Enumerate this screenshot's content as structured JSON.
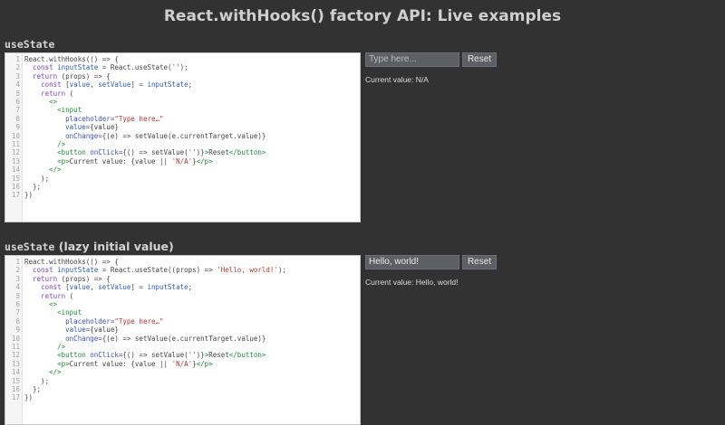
{
  "page": {
    "title": "React.withHooks() factory API: Live examples"
  },
  "examples": [
    {
      "heading_code": "useState",
      "heading_suffix": "",
      "code_lines": [
        [
          {
            "t": "React.withHooks(() => {",
            "c": "p"
          }
        ],
        [
          {
            "t": "  ",
            "c": "p"
          },
          {
            "t": "const",
            "c": "kw"
          },
          {
            "t": " ",
            "c": "p"
          },
          {
            "t": "inputState",
            "c": "var"
          },
          {
            "t": " = React.useState(",
            "c": "p"
          },
          {
            "t": "''",
            "c": "str"
          },
          {
            "t": ");",
            "c": "p"
          }
        ],
        [
          {
            "t": "  ",
            "c": "p"
          },
          {
            "t": "return",
            "c": "kw"
          },
          {
            "t": " (props) => {",
            "c": "p"
          }
        ],
        [
          {
            "t": "    ",
            "c": "p"
          },
          {
            "t": "const",
            "c": "kw"
          },
          {
            "t": " [",
            "c": "p"
          },
          {
            "t": "value",
            "c": "var"
          },
          {
            "t": ", ",
            "c": "p"
          },
          {
            "t": "setValue",
            "c": "var"
          },
          {
            "t": "] = ",
            "c": "p"
          },
          {
            "t": "inputState",
            "c": "var"
          },
          {
            "t": ";",
            "c": "p"
          }
        ],
        [
          {
            "t": "    ",
            "c": "p"
          },
          {
            "t": "return",
            "c": "kw"
          },
          {
            "t": " (",
            "c": "p"
          }
        ],
        [
          {
            "t": "      ",
            "c": "p"
          },
          {
            "t": "<>",
            "c": "tag"
          }
        ],
        [
          {
            "t": "        ",
            "c": "p"
          },
          {
            "t": "<input",
            "c": "tag"
          }
        ],
        [
          {
            "t": "          ",
            "c": "p"
          },
          {
            "t": "placeholder",
            "c": "attr"
          },
          {
            "t": "=",
            "c": "p"
          },
          {
            "t": "\"Type here…\"",
            "c": "str"
          }
        ],
        [
          {
            "t": "          ",
            "c": "p"
          },
          {
            "t": "value",
            "c": "attr"
          },
          {
            "t": "={value}",
            "c": "p"
          }
        ],
        [
          {
            "t": "          ",
            "c": "p"
          },
          {
            "t": "onChange",
            "c": "attr"
          },
          {
            "t": "={(e) => setValue(e.currentTarget.value)}",
            "c": "p"
          }
        ],
        [
          {
            "t": "        ",
            "c": "p"
          },
          {
            "t": "/>",
            "c": "tag"
          }
        ],
        [
          {
            "t": "        ",
            "c": "p"
          },
          {
            "t": "<button",
            "c": "tag"
          },
          {
            "t": " ",
            "c": "p"
          },
          {
            "t": "onClick",
            "c": "attr"
          },
          {
            "t": "={() => setValue(",
            "c": "p"
          },
          {
            "t": "''",
            "c": "str"
          },
          {
            "t": ")}",
            "c": "p"
          },
          {
            "t": ">",
            "c": "tag"
          },
          {
            "t": "Reset",
            "c": "p"
          },
          {
            "t": "</button>",
            "c": "tag"
          }
        ],
        [
          {
            "t": "        ",
            "c": "p"
          },
          {
            "t": "<p>",
            "c": "tag"
          },
          {
            "t": "Current value: {value || ",
            "c": "p"
          },
          {
            "t": "'N/A'",
            "c": "str"
          },
          {
            "t": "}",
            "c": "p"
          },
          {
            "t": "</p>",
            "c": "tag"
          }
        ],
        [
          {
            "t": "      ",
            "c": "p"
          },
          {
            "t": "</>",
            "c": "tag"
          }
        ],
        [
          {
            "t": "    );",
            "c": "p"
          }
        ],
        [
          {
            "t": "  };",
            "c": "p"
          }
        ],
        [
          {
            "t": "})",
            "c": "p"
          }
        ]
      ],
      "input_value": "",
      "input_placeholder": "Type here...",
      "reset_label": "Reset",
      "current_value_text": "Current value: N/A"
    },
    {
      "heading_code": "useState",
      "heading_suffix": " (lazy initial value)",
      "code_lines": [
        [
          {
            "t": "React.withHooks(() => {",
            "c": "p"
          }
        ],
        [
          {
            "t": "  ",
            "c": "p"
          },
          {
            "t": "const",
            "c": "kw"
          },
          {
            "t": " ",
            "c": "p"
          },
          {
            "t": "inputState",
            "c": "var"
          },
          {
            "t": " = React.useState((props) => ",
            "c": "p"
          },
          {
            "t": "'Hello, world!'",
            "c": "str"
          },
          {
            "t": ");",
            "c": "p"
          }
        ],
        [
          {
            "t": "  ",
            "c": "p"
          },
          {
            "t": "return",
            "c": "kw"
          },
          {
            "t": " (props) => {",
            "c": "p"
          }
        ],
        [
          {
            "t": "    ",
            "c": "p"
          },
          {
            "t": "const",
            "c": "kw"
          },
          {
            "t": " [",
            "c": "p"
          },
          {
            "t": "value",
            "c": "var"
          },
          {
            "t": ", ",
            "c": "p"
          },
          {
            "t": "setValue",
            "c": "var"
          },
          {
            "t": "] = ",
            "c": "p"
          },
          {
            "t": "inputState",
            "c": "var"
          },
          {
            "t": ";",
            "c": "p"
          }
        ],
        [
          {
            "t": "    ",
            "c": "p"
          },
          {
            "t": "return",
            "c": "kw"
          },
          {
            "t": " (",
            "c": "p"
          }
        ],
        [
          {
            "t": "      ",
            "c": "p"
          },
          {
            "t": "<>",
            "c": "tag"
          }
        ],
        [
          {
            "t": "        ",
            "c": "p"
          },
          {
            "t": "<input",
            "c": "tag"
          }
        ],
        [
          {
            "t": "          ",
            "c": "p"
          },
          {
            "t": "placeholder",
            "c": "attr"
          },
          {
            "t": "=",
            "c": "p"
          },
          {
            "t": "\"Type here…\"",
            "c": "str"
          }
        ],
        [
          {
            "t": "          ",
            "c": "p"
          },
          {
            "t": "value",
            "c": "attr"
          },
          {
            "t": "={value}",
            "c": "p"
          }
        ],
        [
          {
            "t": "          ",
            "c": "p"
          },
          {
            "t": "onChange",
            "c": "attr"
          },
          {
            "t": "={(e) => setValue(e.currentTarget.value)}",
            "c": "p"
          }
        ],
        [
          {
            "t": "        ",
            "c": "p"
          },
          {
            "t": "/>",
            "c": "tag"
          }
        ],
        [
          {
            "t": "        ",
            "c": "p"
          },
          {
            "t": "<button",
            "c": "tag"
          },
          {
            "t": " ",
            "c": "p"
          },
          {
            "t": "onClick",
            "c": "attr"
          },
          {
            "t": "={() => setValue(",
            "c": "p"
          },
          {
            "t": "''",
            "c": "str"
          },
          {
            "t": ")}",
            "c": "p"
          },
          {
            "t": ">",
            "c": "tag"
          },
          {
            "t": "Reset",
            "c": "p"
          },
          {
            "t": "</button>",
            "c": "tag"
          }
        ],
        [
          {
            "t": "        ",
            "c": "p"
          },
          {
            "t": "<p>",
            "c": "tag"
          },
          {
            "t": "Current value: {value || ",
            "c": "p"
          },
          {
            "t": "'N/A'",
            "c": "str"
          },
          {
            "t": "}",
            "c": "p"
          },
          {
            "t": "</p>",
            "c": "tag"
          }
        ],
        [
          {
            "t": "      ",
            "c": "p"
          },
          {
            "t": "</>",
            "c": "tag"
          }
        ],
        [
          {
            "t": "    );",
            "c": "p"
          }
        ],
        [
          {
            "t": "  };",
            "c": "p"
          }
        ],
        [
          {
            "t": "})",
            "c": "p"
          }
        ]
      ],
      "input_value": "Hello, world!",
      "input_placeholder": "Type here...",
      "reset_label": "Reset",
      "current_value_text": "Current value: Hello, world!"
    }
  ],
  "colors": {
    "background": "#323232",
    "editor_background": "#ffffff",
    "keyword": "#7a3fc8",
    "string": "#b5362d",
    "tag": "#1d8a3a",
    "attribute": "#3a52c8"
  }
}
